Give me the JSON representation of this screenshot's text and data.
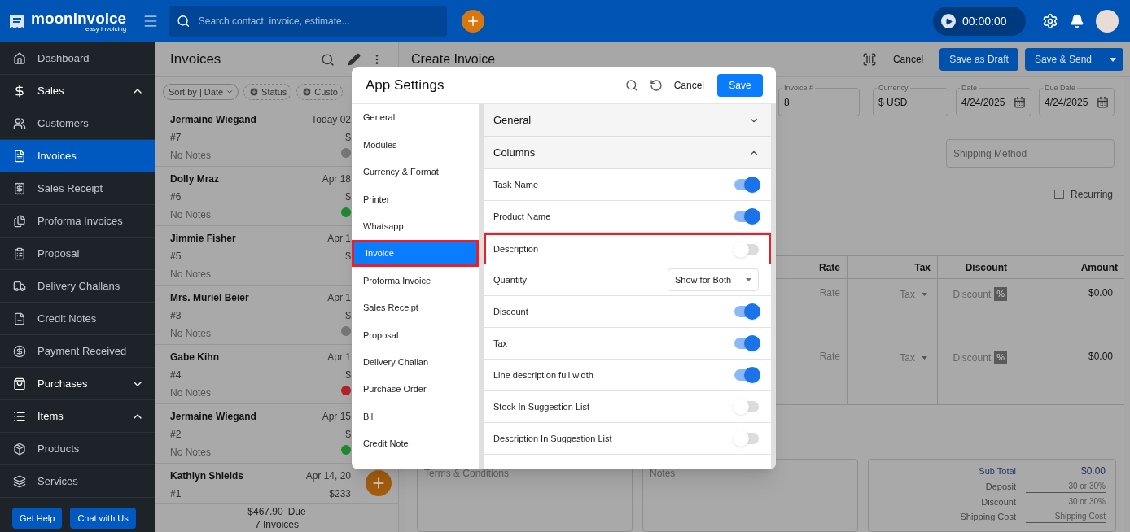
{
  "topbar": {
    "logo_name": "mooninvoice",
    "logo_tagline": "easy invoicing",
    "search": {
      "placeholder": "Search contact, invoice, estimate..."
    },
    "timer": "00:00:00"
  },
  "sidebar": {
    "items": [
      {
        "kind": "item",
        "label": "Dashboard",
        "selected": false
      },
      {
        "kind": "group",
        "label": "Sales",
        "expanded": true
      },
      {
        "kind": "item",
        "label": "Customers",
        "selected": false
      },
      {
        "kind": "item",
        "label": "Invoices",
        "selected": true
      },
      {
        "kind": "item",
        "label": "Sales Receipt",
        "selected": false
      },
      {
        "kind": "item",
        "label": "Proforma Invoices",
        "selected": false
      },
      {
        "kind": "item",
        "label": "Proposal",
        "selected": false
      },
      {
        "kind": "item",
        "label": "Delivery Challans",
        "selected": false
      },
      {
        "kind": "item",
        "label": "Credit Notes",
        "selected": false
      },
      {
        "kind": "item",
        "label": "Payment Received",
        "selected": false
      },
      {
        "kind": "group",
        "label": "Purchases",
        "expanded": false
      },
      {
        "kind": "group",
        "label": "Items",
        "expanded": true
      },
      {
        "kind": "item",
        "label": "Products",
        "selected": false
      },
      {
        "kind": "item",
        "label": "Services",
        "selected": false
      }
    ],
    "buttons": [
      "Get Help",
      "Chat with Us"
    ]
  },
  "invoice_list": {
    "title": "Invoices",
    "filters": [
      {
        "kind": "sort",
        "label": "Sort by | Date"
      },
      {
        "kind": "add",
        "label": "Status"
      },
      {
        "kind": "add",
        "label": "Custo"
      }
    ],
    "rows": [
      {
        "name": "Jermaine Wiegand",
        "number": "#7",
        "notes": "No Notes",
        "date": "Today 02",
        "amount": "$",
        "color": "#777777"
      },
      {
        "name": "Dolly Mraz",
        "number": "#6",
        "notes": "No Notes",
        "date": "Apr 18",
        "amount": "$",
        "color": "#1e8a30"
      },
      {
        "name": "Jimmie Fisher",
        "number": "#5",
        "notes": "No Notes",
        "date": "Apr 1",
        "amount": "$"
      },
      {
        "name": "Mrs. Muriel Beier",
        "number": "#3",
        "notes": "No Notes",
        "date": "Apr 1",
        "amount": "$",
        "color": "#777777"
      },
      {
        "name": "Gabe Kihn",
        "number": "#4",
        "notes": "No Notes",
        "date": "Apr 1",
        "amount": "$",
        "color": "#b5222a"
      },
      {
        "name": "Jermaine Wiegand",
        "number": "#2",
        "notes": "No Notes",
        "date": "Apr 15",
        "amount": "$",
        "color": "#1e8a30"
      },
      {
        "name": "Kathlyn Shields",
        "number": "#1",
        "date": "Apr 14, 20",
        "amount": "$233"
      }
    ],
    "footer": {
      "due": "$467.90",
      "due_label": "Due",
      "count": "7 Invoices"
    }
  },
  "create_invoice": {
    "title": "Create Invoice",
    "cancel": "Cancel",
    "save_draft": "Save as Draft",
    "save_send": "Save & Send",
    "fields": [
      {
        "kind": "text",
        "label": "Invoice #",
        "value": "8"
      },
      {
        "kind": "text",
        "label": "Currency",
        "value": "$ USD"
      },
      {
        "kind": "date",
        "label": "Date",
        "value": "4/24/2025"
      },
      {
        "kind": "date",
        "label": "Due Date",
        "value": "4/24/2025"
      }
    ],
    "shipping": {
      "placeholder": "Shipping Method"
    },
    "recurring": {
      "label": "Recurring",
      "checked": false
    },
    "table": {
      "columns": [
        "Rate",
        "Tax",
        "Discount",
        "Amount"
      ],
      "rows": [
        {
          "rate": "Rate",
          "tax": "Tax",
          "discount": "Discount",
          "unit": "%",
          "amount": "$0.00"
        },
        {
          "rate": "Rate",
          "tax": "Tax",
          "discount": "Discount",
          "unit": "%",
          "amount": "$0.00"
        }
      ]
    },
    "terms": {
      "placeholder": "Terms & Conditions"
    },
    "notes": {
      "placeholder": "Notes"
    },
    "totals": [
      {
        "kind": "value",
        "label": "Sub Total",
        "value": "$0.00"
      },
      {
        "kind": "input",
        "label": "Deposit",
        "placeholder": "30 or 30%"
      },
      {
        "kind": "input",
        "label": "Discount",
        "placeholder": "30 or 30%"
      },
      {
        "kind": "input",
        "label": "Shipping Cost",
        "placeholder": "Shipping Cost"
      }
    ]
  },
  "app_settings": {
    "title": "App Settings",
    "cancel": "Cancel",
    "save": "Save",
    "nav": [
      {
        "label": "General",
        "selected": false,
        "highlighted": false
      },
      {
        "label": "Modules",
        "selected": false,
        "highlighted": false
      },
      {
        "label": "Currency & Format",
        "selected": false,
        "highlighted": false
      },
      {
        "label": "Printer",
        "selected": false,
        "highlighted": false
      },
      {
        "label": "Whatsapp",
        "selected": false,
        "highlighted": false
      },
      {
        "label": "Invoice",
        "selected": true,
        "highlighted": true
      },
      {
        "label": "Proforma Invoice",
        "selected": false,
        "highlighted": false
      },
      {
        "label": "Sales Receipt",
        "selected": false,
        "highlighted": false
      },
      {
        "label": "Proposal",
        "selected": false,
        "highlighted": false
      },
      {
        "label": "Delivery Challan",
        "selected": false,
        "highlighted": false
      },
      {
        "label": "Purchase Order",
        "selected": false,
        "highlighted": false
      },
      {
        "label": "Bill",
        "selected": false,
        "highlighted": false
      },
      {
        "label": "Credit Note",
        "selected": false,
        "highlighted": false
      }
    ],
    "sections": [
      {
        "title": "General",
        "expanded": false
      },
      {
        "title": "Columns",
        "expanded": true
      }
    ],
    "columns": [
      {
        "kind": "toggle",
        "label": "Task Name",
        "on": true,
        "highlighted": false
      },
      {
        "kind": "toggle",
        "label": "Product Name",
        "on": true,
        "highlighted": false
      },
      {
        "kind": "toggle",
        "label": "Description",
        "on": false,
        "highlighted": true
      },
      {
        "kind": "select",
        "label": "Quantity",
        "value": "Show for Both",
        "highlighted": false
      },
      {
        "kind": "toggle",
        "label": "Discount",
        "on": true,
        "highlighted": false
      },
      {
        "kind": "toggle",
        "label": "Tax",
        "on": true,
        "highlighted": false
      },
      {
        "kind": "toggle",
        "label": "Line description full width",
        "on": true,
        "highlighted": false
      },
      {
        "kind": "toggle",
        "label": "Stock In Suggestion List",
        "on": false,
        "highlighted": false
      },
      {
        "kind": "toggle",
        "label": "Description In Suggestion List",
        "on": false,
        "highlighted": false
      }
    ]
  }
}
